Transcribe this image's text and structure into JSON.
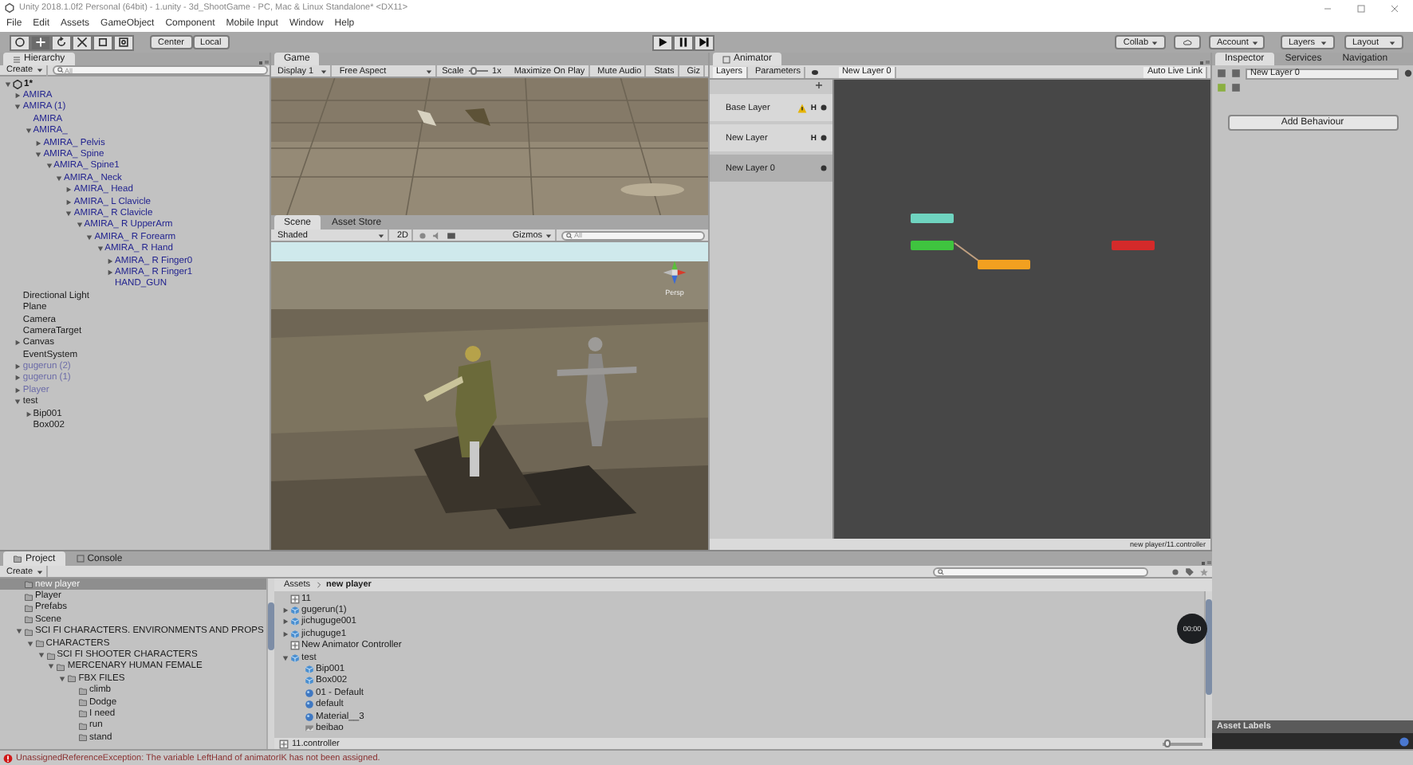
{
  "window": {
    "title": "Unity 2018.1.0f2 Personal (64bit) - 1.unity - 3d_ShootGame - PC, Mac & Linux Standalone* <DX11>"
  },
  "menu": [
    "File",
    "Edit",
    "Assets",
    "GameObject",
    "Component",
    "Mobile Input",
    "Window",
    "Help"
  ],
  "toolbar": {
    "tools": [
      {
        "kind": "hand",
        "selected": false
      },
      {
        "kind": "move",
        "selected": true
      },
      {
        "kind": "rotate",
        "selected": false
      },
      {
        "kind": "scale",
        "selected": false
      },
      {
        "kind": "rect",
        "selected": false
      },
      {
        "kind": "transform",
        "selected": false
      }
    ],
    "pivot": [
      "Center",
      "Local"
    ],
    "playback": [
      {
        "kind": "play"
      },
      {
        "kind": "pause"
      },
      {
        "kind": "step"
      }
    ],
    "collab": "Collab",
    "account": "Account",
    "layers": "Layers",
    "layout": "Layout"
  },
  "hierarchy": {
    "tab": "Hierarchy",
    "create": "Create",
    "search_placeholder": "All",
    "scene": {
      "name": "1*",
      "expanded": true,
      "children": [
        {
          "name": "AMIRA",
          "kind": "prefab",
          "expanded": false
        },
        {
          "name": "AMIRA (1)",
          "kind": "prefab",
          "expanded": true,
          "children": [
            {
              "name": "AMIRA",
              "kind": "prefab"
            },
            {
              "name": "AMIRA_",
              "kind": "prefab",
              "expanded": true,
              "children": [
                {
                  "name": "AMIRA_ Pelvis",
                  "kind": "prefab",
                  "expanded": false
                },
                {
                  "name": "AMIRA_ Spine",
                  "kind": "prefab",
                  "expanded": true,
                  "children": [
                    {
                      "name": "AMIRA_ Spine1",
                      "kind": "prefab",
                      "expanded": true,
                      "children": [
                        {
                          "name": "AMIRA_ Neck",
                          "kind": "prefab",
                          "expanded": true,
                          "children": [
                            {
                              "name": "AMIRA_ Head",
                              "kind": "prefab",
                              "expanded": false
                            },
                            {
                              "name": "AMIRA_ L Clavicle",
                              "kind": "prefab",
                              "expanded": false
                            },
                            {
                              "name": "AMIRA_ R Clavicle",
                              "kind": "prefab",
                              "expanded": true,
                              "children": [
                                {
                                  "name": "AMIRA_ R UpperArm",
                                  "kind": "prefab",
                                  "expanded": true,
                                  "children": [
                                    {
                                      "name": "AMIRA_ R Forearm",
                                      "kind": "prefab",
                                      "expanded": true,
                                      "children": [
                                        {
                                          "name": "AMIRA_ R Hand",
                                          "kind": "prefab",
                                          "expanded": true,
                                          "children": [
                                            {
                                              "name": "AMIRA_ R Finger0",
                                              "kind": "prefab",
                                              "expanded": false
                                            },
                                            {
                                              "name": "AMIRA_ R Finger1",
                                              "kind": "prefab",
                                              "expanded": false
                                            },
                                            {
                                              "name": "HAND_GUN",
                                              "kind": "prefab"
                                            }
                                          ]
                                        }
                                      ]
                                    }
                                  ]
                                }
                              ]
                            }
                          ]
                        }
                      ]
                    }
                  ]
                }
              ]
            }
          ]
        },
        {
          "name": "Directional Light",
          "kind": "object"
        },
        {
          "name": "Plane",
          "kind": "object"
        },
        {
          "name": "Camera",
          "kind": "object"
        },
        {
          "name": "CameraTarget",
          "kind": "object"
        },
        {
          "name": "Canvas",
          "kind": "object",
          "expanded": false
        },
        {
          "name": "EventSystem",
          "kind": "object"
        },
        {
          "name": "gugerun (2)",
          "kind": "inactive",
          "expanded": false
        },
        {
          "name": "gugerun (1)",
          "kind": "inactive",
          "expanded": false
        },
        {
          "name": "Player",
          "kind": "inactive",
          "expanded": false
        },
        {
          "name": "test",
          "kind": "object",
          "expanded": true,
          "children": [
            {
              "name": "Bip001",
              "kind": "object",
              "expanded": false
            },
            {
              "name": "Box002",
              "kind": "object"
            }
          ]
        }
      ]
    }
  },
  "game": {
    "tabs": [
      {
        "label": "Game",
        "selected": true
      }
    ],
    "display": "Display 1",
    "aspect": "Free Aspect",
    "scale": {
      "label": "Scale",
      "level": 0.1,
      "value": "1x"
    },
    "buttons": [
      "Maximize On Play",
      "Mute Audio",
      "Stats",
      "Giz"
    ]
  },
  "scene": {
    "tabs": [
      {
        "label": "Scene",
        "selected": true
      },
      {
        "label": "Asset Store",
        "selected": false
      }
    ],
    "shading": "Shaded",
    "mode_2d": "2D",
    "gizmos": "Gizmos",
    "search_placeholder": "All",
    "view_label": "Persp"
  },
  "animator": {
    "tab": "Animator",
    "subtabs": [
      {
        "label": "Layers",
        "selected": true
      },
      {
        "label": "Parameters",
        "selected": false
      }
    ],
    "breadcrumb": "New Layer 0",
    "live_link": "Auto Live Link",
    "layers": [
      {
        "name": "Base Layer",
        "warning": true,
        "badge": "H",
        "selected": false
      },
      {
        "name": "New Layer",
        "warning": false,
        "badge": "H",
        "selected": false
      },
      {
        "name": "New Layer 0",
        "warning": false,
        "selected": true
      }
    ],
    "states": [
      {
        "color": "#6fd4c0"
      },
      {
        "color": "#3fc43f"
      },
      {
        "color": "#f2a020"
      },
      {
        "color": "#d42a2a"
      }
    ],
    "footer": "new player/11.controller"
  },
  "inspector": {
    "tabs": [
      {
        "label": "Inspector",
        "selected": true
      },
      {
        "label": "Services",
        "selected": false
      },
      {
        "label": "Navigation",
        "selected": false
      }
    ],
    "name_value": "New Layer 0",
    "add_button": "Add Behaviour",
    "labels_title": "Asset Labels"
  },
  "project": {
    "tabs": [
      {
        "label": "Project",
        "selected": true
      },
      {
        "label": "Console",
        "selected": false
      }
    ],
    "create": "Create",
    "folders": [
      {
        "name": "new player",
        "selected": true
      },
      {
        "name": "Player",
        "selected": false
      },
      {
        "name": "Prefabs",
        "selected": false
      },
      {
        "name": "Scene",
        "selected": false
      },
      {
        "name": "SCI FI CHARACTERS. ENVIRONMENTS AND PROPS",
        "selected": false,
        "expanded": true,
        "children": [
          {
            "name": "CHARACTERS",
            "selected": false,
            "expanded": true,
            "children": [
              {
                "name": "SCI FI SHOOTER CHARACTERS",
                "selected": false,
                "expanded": true,
                "children": [
                  {
                    "name": "MERCENARY HUMAN FEMALE",
                    "selected": false,
                    "expanded": true,
                    "children": [
                      {
                        "name": "FBX FILES",
                        "selected": false,
                        "expanded": true,
                        "children": [
                          {
                            "name": "climb",
                            "selected": false
                          },
                          {
                            "name": "Dodge",
                            "selected": false
                          },
                          {
                            "name": "I need",
                            "selected": false
                          },
                          {
                            "name": "run",
                            "selected": false
                          },
                          {
                            "name": "stand",
                            "selected": false
                          }
                        ]
                      }
                    ]
                  }
                ]
              }
            ]
          }
        ]
      }
    ],
    "breadcrumb": [
      "Assets",
      "new player"
    ],
    "assets": [
      {
        "name": "11",
        "kind": "controller"
      },
      {
        "name": "gugerun(1)",
        "kind": "model",
        "expanded": false
      },
      {
        "name": "jichuguge001",
        "kind": "model",
        "expanded": false
      },
      {
        "name": "jichuguge1",
        "kind": "model",
        "expanded": false
      },
      {
        "name": "New Animator Controller",
        "kind": "controller"
      },
      {
        "name": "test",
        "kind": "model",
        "expanded": true,
        "children": [
          {
            "name": "Bip001",
            "kind": "model"
          },
          {
            "name": "Box002",
            "kind": "model"
          },
          {
            "name": "01 - Default",
            "kind": "material"
          },
          {
            "name": "default",
            "kind": "material"
          },
          {
            "name": "Material__3",
            "kind": "material"
          },
          {
            "name": "beibao",
            "kind": "texture"
          }
        ]
      }
    ],
    "selected_file": "11.controller",
    "icon_size": {
      "level": 0.05
    }
  },
  "recording_timer": "00:00",
  "status": {
    "kind": "error",
    "message": "UnassignedReferenceException: The variable LeftHand of animatorIK has not been assigned."
  }
}
